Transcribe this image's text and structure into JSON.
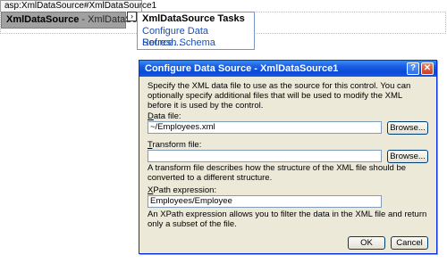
{
  "designer": {
    "tag_label": "asp:XmlDataSource#XmlDataSource1",
    "control_type": "XmlDataSource",
    "control_separator": " - ",
    "control_id": "XmlDataSource1",
    "smart_tag_glyph": "›"
  },
  "tasks_panel": {
    "title": "XmlDataSource Tasks",
    "links": [
      {
        "label": "Configure Data Source..."
      },
      {
        "label": "Refresh Schema"
      }
    ]
  },
  "dialog": {
    "title": "Configure Data Source - XmlDataSource1",
    "help_glyph": "?",
    "close_glyph": "✕",
    "description": "Specify the XML data file to use as the source for this control. You can optionally specify additional files that will be used to modify the XML before it is used by the control.",
    "data_file": {
      "label_mnemonic": "D",
      "label_rest": "ata file:",
      "value": "~/Employees.xml",
      "browse_label": "Browse..."
    },
    "transform_file": {
      "label_mnemonic": "T",
      "label_rest": "ransform file:",
      "value": "",
      "browse_label": "Browse...",
      "note": "A transform file describes how the structure of the XML file should be converted to a different structure."
    },
    "xpath": {
      "label_mnemonic": "X",
      "label_rest": "Path expression:",
      "value": "Employees/Employee",
      "note": "An XPath expression allows you to filter the data in the XML file and return only a subset of the file."
    },
    "ok_label": "OK",
    "cancel_label": "Cancel"
  },
  "colors": {
    "titlebar": "#0c4ad6",
    "dialog_face": "#ece9d8",
    "link": "#1c4fb4",
    "control_box": "#a0a0a0"
  }
}
